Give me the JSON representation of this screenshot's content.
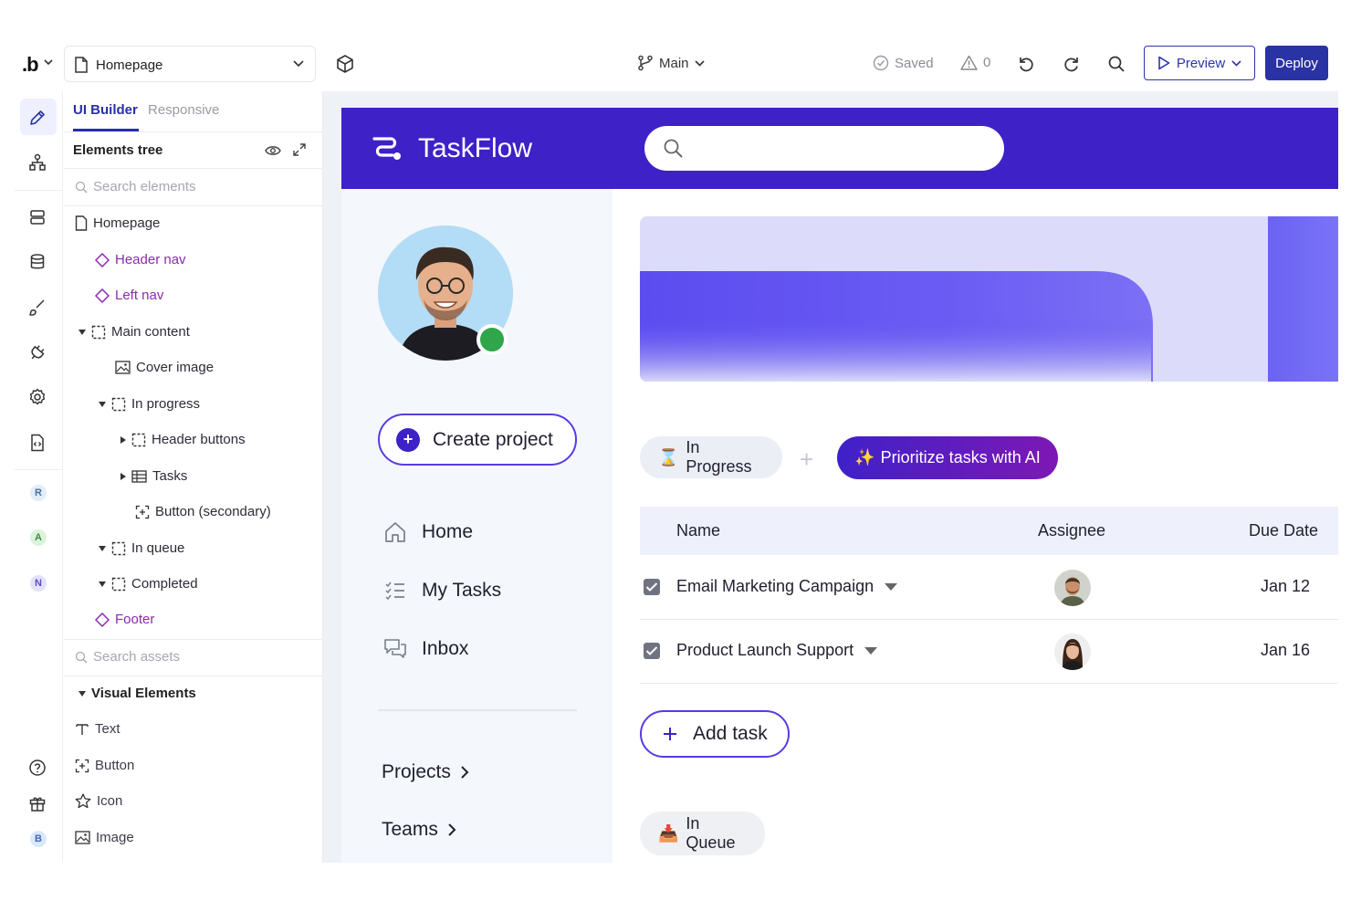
{
  "topbar": {
    "logo": ".b",
    "page_name": "Homepage",
    "branch": "Main",
    "saved": "Saved",
    "warnings": "0",
    "preview_label": "Preview",
    "deploy_label": "Deploy"
  },
  "rail": {
    "avatars": [
      {
        "letter": "R",
        "bg": "#e4edf7",
        "fg": "#4a6fa5"
      },
      {
        "letter": "A",
        "bg": "#dcf2dc",
        "fg": "#3f8c3f"
      },
      {
        "letter": "N",
        "bg": "#e4e2fb",
        "fg": "#5a4fc7"
      },
      {
        "letter": "B",
        "bg": "#dbe8fb",
        "fg": "#3f67b5"
      }
    ]
  },
  "panel": {
    "tab_active": "UI Builder",
    "tab_inactive": "Responsive",
    "tree_title": "Elements tree",
    "search_elements_placeholder": "Search elements",
    "tree": [
      {
        "label": "Homepage"
      },
      {
        "label": "Header nav"
      },
      {
        "label": "Left nav"
      },
      {
        "label": "Main content"
      },
      {
        "label": "Cover image"
      },
      {
        "label": "In progress"
      },
      {
        "label": "Header buttons"
      },
      {
        "label": "Tasks"
      },
      {
        "label": "Button (secondary)"
      },
      {
        "label": "In queue"
      },
      {
        "label": "Completed"
      },
      {
        "label": "Footer"
      }
    ],
    "search_assets_placeholder": "Search assets",
    "assets_section": "Visual Elements",
    "assets": [
      {
        "label": "Text"
      },
      {
        "label": "Button"
      },
      {
        "label": "Icon"
      },
      {
        "label": "Image"
      }
    ]
  },
  "app": {
    "name": "TaskFlow",
    "create_project": "Create project",
    "nav": [
      {
        "label": "Home",
        "icon": "home-icon"
      },
      {
        "label": "My Tasks",
        "icon": "task-list-icon"
      },
      {
        "label": "Inbox",
        "icon": "inbox-icon"
      }
    ],
    "links": [
      {
        "label": "Projects"
      },
      {
        "label": "Teams"
      }
    ],
    "in_progress_label": "In Progress",
    "ai_button": "Prioritize tasks with AI",
    "table_headers": {
      "name": "Name",
      "assignee": "Assignee",
      "due": "Due Date"
    },
    "tasks": [
      {
        "name": "Email Marketing Campaign",
        "due": "Jan 12"
      },
      {
        "name": "Product Launch Support",
        "due": "Jan 16"
      }
    ],
    "add_task": "Add task",
    "in_queue_label": "In Queue"
  },
  "colors": {
    "brand": "#3f21c8",
    "accent_blue": "#2a33a3",
    "component_purple": "#8b2bb0",
    "online": "#2fa64a"
  }
}
